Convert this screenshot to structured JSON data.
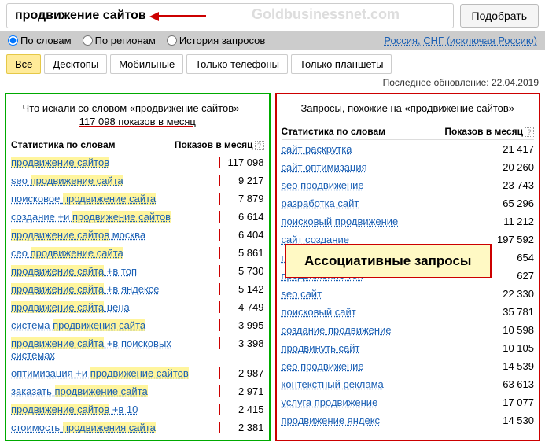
{
  "search": {
    "value": "продвижение сайтов",
    "submit": "Подобрать"
  },
  "watermark": "Goldbusinessnet.com",
  "filters": {
    "by_words": "По словам",
    "by_regions": "По регионам",
    "history": "История запросов",
    "region": "Россия, СНГ (исключая Россию)"
  },
  "tabs": {
    "all": "Все",
    "desktops": "Десктопы",
    "mobile": "Мобильные",
    "phones": "Только телефоны",
    "tablets": "Только планшеты"
  },
  "updated": "Последнее обновление: 22.04.2019",
  "left": {
    "title_pre": "Что искали со словом «продвижение сайтов» — ",
    "title_count": "117 098 показов в месяц",
    "head_stat": "Статистика по словам",
    "head_count": "Показов в месяц",
    "rows": [
      {
        "pre": "",
        "hl": "продвижение сайтов",
        "post": "",
        "n": "117 098"
      },
      {
        "pre": "seo ",
        "hl": "продвижение сайта",
        "post": "",
        "n": "9 217"
      },
      {
        "pre": "поисковое ",
        "hl": "продвижение сайта",
        "post": "",
        "n": "7 879"
      },
      {
        "pre": "создание +и ",
        "hl": "продвижение сайтов",
        "post": "",
        "n": "6 614"
      },
      {
        "pre": "",
        "hl": "продвижение сайтов",
        "post": " москва",
        "n": "6 404"
      },
      {
        "pre": "сео ",
        "hl": "продвижение сайта",
        "post": "",
        "n": "5 861"
      },
      {
        "pre": "",
        "hl": "продвижение сайта",
        "post": " +в топ",
        "n": "5 730"
      },
      {
        "pre": "",
        "hl": "продвижение сайта",
        "post": " +в яндексе",
        "n": "5 142"
      },
      {
        "pre": "",
        "hl": "продвижение сайта",
        "post": " цена",
        "n": "4 749"
      },
      {
        "pre": "система ",
        "hl": "продвижения сайта",
        "post": "",
        "n": "3 995"
      },
      {
        "pre": "",
        "hl": "продвижение сайта",
        "post": " +в поисковых системах",
        "n": "3 398"
      },
      {
        "pre": "оптимизация +и ",
        "hl": "продвижение сайтов",
        "post": "",
        "n": "2 987"
      },
      {
        "pre": "заказать ",
        "hl": "продвижение сайта",
        "post": "",
        "n": "2 971"
      },
      {
        "pre": "",
        "hl": "продвижение сайтов",
        "post": " +в 10",
        "n": "2 415"
      },
      {
        "pre": "стоимость ",
        "hl": "продвижения сайта",
        "post": "",
        "n": "2 381"
      }
    ]
  },
  "right": {
    "title": "Запросы, похожие на «продвижение сайтов»",
    "head_stat": "Статистика по словам",
    "head_count": "Показов в месяц",
    "callout": "Ассоциативные запросы",
    "rows": [
      {
        "t": "сайт раскрутка",
        "n": "21 417"
      },
      {
        "t": "сайт оптимизация",
        "n": "20 260"
      },
      {
        "t": "seo продвижение",
        "n": "23 743"
      },
      {
        "t": "разработка сайт",
        "n": "65 296"
      },
      {
        "t": "поисковый продвижение",
        "n": "11 212"
      },
      {
        "t": "сайт создание",
        "n": "197 592"
      },
      {
        "t": "продвижение интернет",
        "n": "654"
      },
      {
        "t": "продвижение топ",
        "n": "627"
      },
      {
        "t": "seo сайт",
        "n": "22 330"
      },
      {
        "t": "поисковый сайт",
        "n": "35 781"
      },
      {
        "t": "создание продвижение",
        "n": "10 598"
      },
      {
        "t": "продвинуть сайт",
        "n": "10 105"
      },
      {
        "t": "сео продвижение",
        "n": "14 539"
      },
      {
        "t": "контекстный реклама",
        "n": "63 613"
      },
      {
        "t": "услуга продвижение",
        "n": "17 077"
      },
      {
        "t": "продвижение яндекс",
        "n": "14 530"
      }
    ]
  }
}
